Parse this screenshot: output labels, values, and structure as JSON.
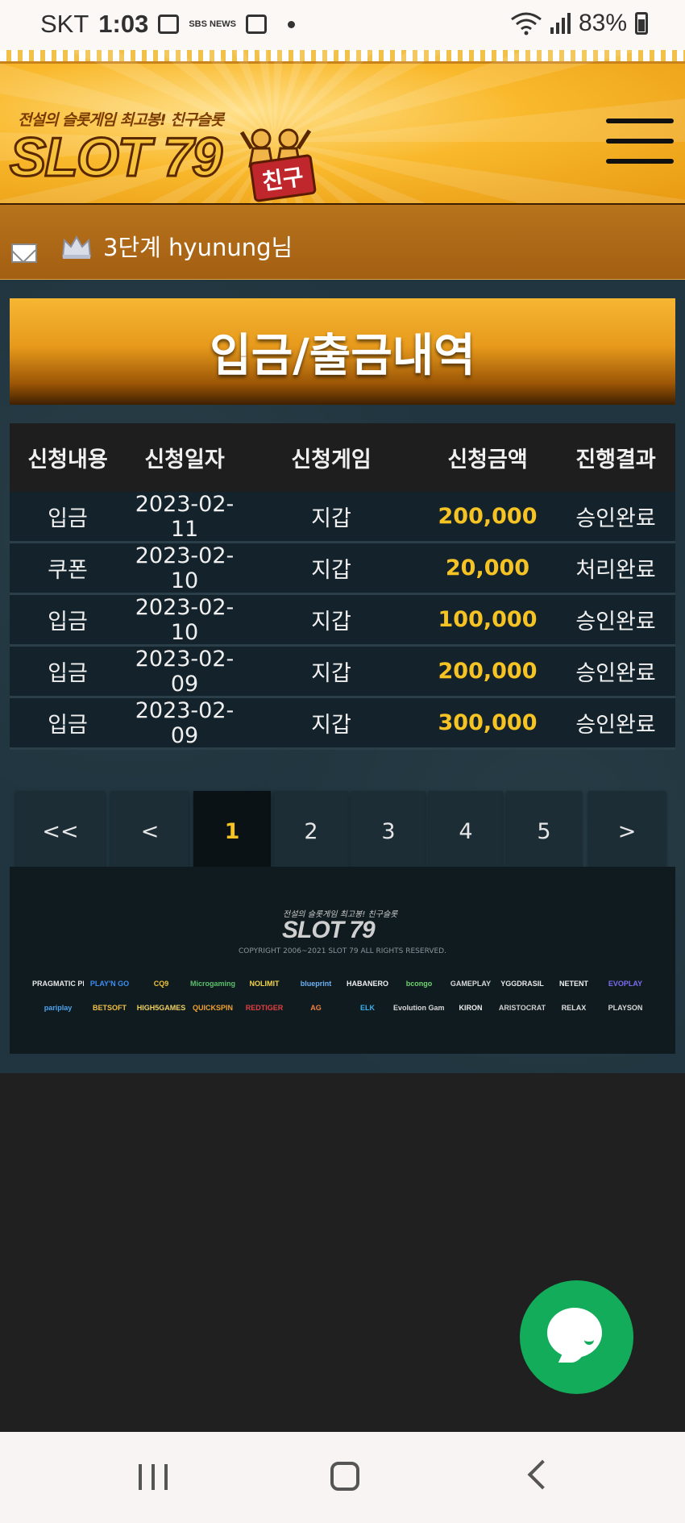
{
  "status_bar": {
    "carrier": "SKT",
    "time": "1:03",
    "sbs_text": "SBS NEWS",
    "battery": "83%"
  },
  "header": {
    "logo_tagline": "전설의 슬롯게임 최고봉! 친구슬롯",
    "logo_text": "SLOT 79",
    "logo_badge": "친구"
  },
  "user": {
    "greeting": "3단계 hyunung님"
  },
  "page_title": "입금/출금내역",
  "table": {
    "headers": [
      "신청내용",
      "신청일자",
      "신청게임",
      "신청금액",
      "진행결과"
    ],
    "rows": [
      {
        "type": "입금",
        "date": "2023-02-11",
        "game": "지갑",
        "amount": "200,000",
        "result": "승인완료"
      },
      {
        "type": "쿠폰",
        "date": "2023-02-10",
        "game": "지갑",
        "amount": "20,000",
        "result": "처리완료"
      },
      {
        "type": "입금",
        "date": "2023-02-10",
        "game": "지갑",
        "amount": "100,000",
        "result": "승인완료"
      },
      {
        "type": "입금",
        "date": "2023-02-09",
        "game": "지갑",
        "amount": "200,000",
        "result": "승인완료"
      },
      {
        "type": "입금",
        "date": "2023-02-09",
        "game": "지갑",
        "amount": "300,000",
        "result": "승인완료"
      }
    ]
  },
  "pagination": {
    "first": "<<",
    "prev": "<",
    "pages": [
      "1",
      "2",
      "3",
      "4",
      "5"
    ],
    "current": "1",
    "next": ">"
  },
  "footer": {
    "logo_tagline": "전설의 슬롯게임 최고봉! 친구슬롯",
    "logo_text": "SLOT 79",
    "copyright": "COPYRIGHT 2006~2021 SLOT 79 ALL RIGHTS RESERVED.",
    "providers": [
      "PRAGMATIC PLAY",
      "PLAY'N GO",
      "CQ9",
      "Microgaming",
      "NOLIMIT",
      "blueprint",
      "HABANERO",
      "bcongo",
      "GAMEPLAY",
      "YGGDRASIL",
      "NETENT",
      "EVOPLAY",
      "pariplay",
      "BETSOFT",
      "HIGH5GAMES",
      "QUICKSPIN",
      "REDTIGER",
      "AG",
      "ELK",
      "Evolution Gaming",
      "KIRON",
      "ARISTOCRAT",
      "RELAX",
      "PLAYSON"
    ]
  },
  "colors": {
    "amount": "#f6c324",
    "chat": "#12ac5b",
    "header": "#f9b92d"
  }
}
